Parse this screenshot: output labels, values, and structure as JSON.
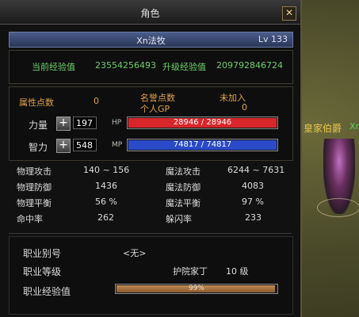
{
  "window": {
    "title": "角色",
    "close_icon": "close-icon"
  },
  "character": {
    "name": "Xn法牧",
    "level": "Lv 133"
  },
  "exp": {
    "current_label": "当前经验值",
    "current_value": "23554256493",
    "next_label": "升级经验值",
    "next_value": "209792846724"
  },
  "points": {
    "attr_label": "属性点数",
    "attr_value": "0",
    "honor_label": "名誉点数",
    "honor_value": "未加入",
    "gp_label": "个人GP",
    "gp_value": "0"
  },
  "strength": {
    "label": "力量",
    "value": "197",
    "bar_label": "HP",
    "bar_text": "28946 / 28946",
    "fill": 1.0,
    "color": "#d8262a"
  },
  "intelligence": {
    "label": "智力",
    "value": "548",
    "bar_label": "MP",
    "bar_text": "74817 / 74817",
    "fill": 1.0,
    "color": "#2a4ac8"
  },
  "stats": {
    "left": [
      {
        "label": "物理攻击",
        "value": "140 ~ 156"
      },
      {
        "label": "物理防御",
        "value": "1436"
      },
      {
        "label": "物理平衡",
        "value": "56 %"
      },
      {
        "label": "命中率",
        "value": "262"
      }
    ],
    "right": [
      {
        "label": "魔法攻击",
        "value": "6244 ~ 7631"
      },
      {
        "label": "魔法防御",
        "value": "4083"
      },
      {
        "label": "魔法平衡",
        "value": "97 %"
      },
      {
        "label": "躲闪率",
        "value": "233"
      }
    ]
  },
  "job": {
    "alias_label": "职业别号",
    "alias_value": "<无>",
    "level_label": "职业等级",
    "title_value": "护院家丁",
    "level_value": "10 级",
    "exp_label": "职业经验值",
    "exp_text": "99%",
    "exp_fill": 0.99
  },
  "world": {
    "npc_name": "皇家伯爵",
    "npc_name_cut": "Xn"
  }
}
